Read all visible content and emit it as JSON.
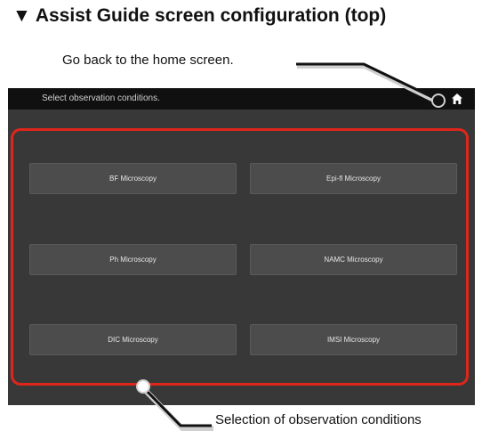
{
  "heading": "▼ Assist Guide screen configuration (top)",
  "annotations": {
    "home": "Go back to the home screen.",
    "selection": "Selection of observation conditions"
  },
  "screen": {
    "title": "Select observation conditions.",
    "home_icon": "home-icon",
    "buttons": [
      "BF Microscopy",
      "Epi-fl Microscopy",
      "Ph Microscopy",
      "NAMC Microscopy",
      "DIC Microscopy",
      "IMSI Microscopy"
    ]
  },
  "colors": {
    "screen_bg": "#383838",
    "header_bg": "#101010",
    "button_bg": "#4c4c4c",
    "highlight": "#e0261b"
  }
}
